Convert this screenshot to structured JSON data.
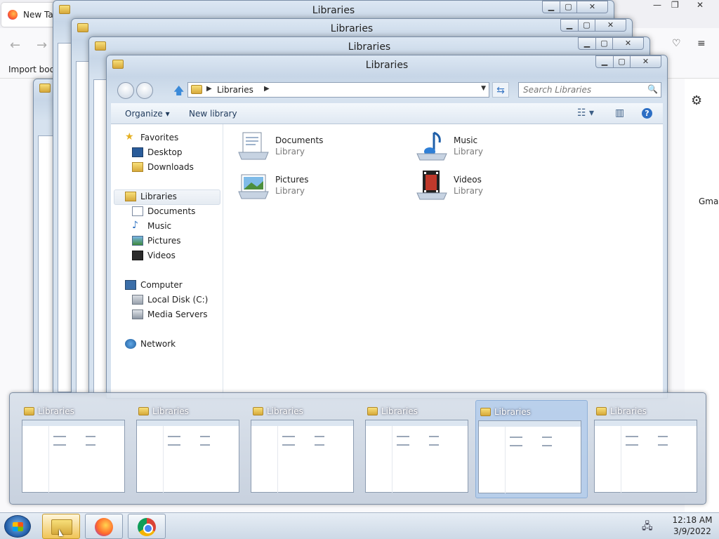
{
  "firefox": {
    "tab_title": "New Tab",
    "bookmark_label": "Import bookmarks...",
    "right_label": "Gmail"
  },
  "explorer": {
    "window_title": "Libraries",
    "address": "Libraries",
    "search_placeholder": "Search Libraries",
    "toolbar": {
      "organize": "Organize",
      "new_library": "New library"
    },
    "nav": {
      "favorites": "Favorites",
      "desktop": "Desktop",
      "downloads": "Downloads",
      "libraries": "Libraries",
      "documents": "Documents",
      "music": "Music",
      "pictures": "Pictures",
      "videos": "Videos",
      "computer": "Computer",
      "local_disk": "Local Disk (C:)",
      "media_servers": "Media Servers",
      "network": "Network"
    },
    "libraries": [
      {
        "name": "Documents",
        "type": "Library",
        "icon": "documents-library-icon"
      },
      {
        "name": "Music",
        "type": "Library",
        "icon": "music-library-icon"
      },
      {
        "name": "Pictures",
        "type": "Library",
        "icon": "pictures-library-icon"
      },
      {
        "name": "Videos",
        "type": "Library",
        "icon": "videos-library-icon"
      }
    ]
  },
  "alt_tab": {
    "thumbnails": [
      {
        "title": "Libraries"
      },
      {
        "title": "Libraries"
      },
      {
        "title": "Libraries"
      },
      {
        "title": "Libraries"
      },
      {
        "title": "Libraries",
        "selected": true
      },
      {
        "title": "Libraries"
      }
    ]
  },
  "taskbar": {
    "time": "12:18 AM",
    "date": "3/9/2022"
  }
}
